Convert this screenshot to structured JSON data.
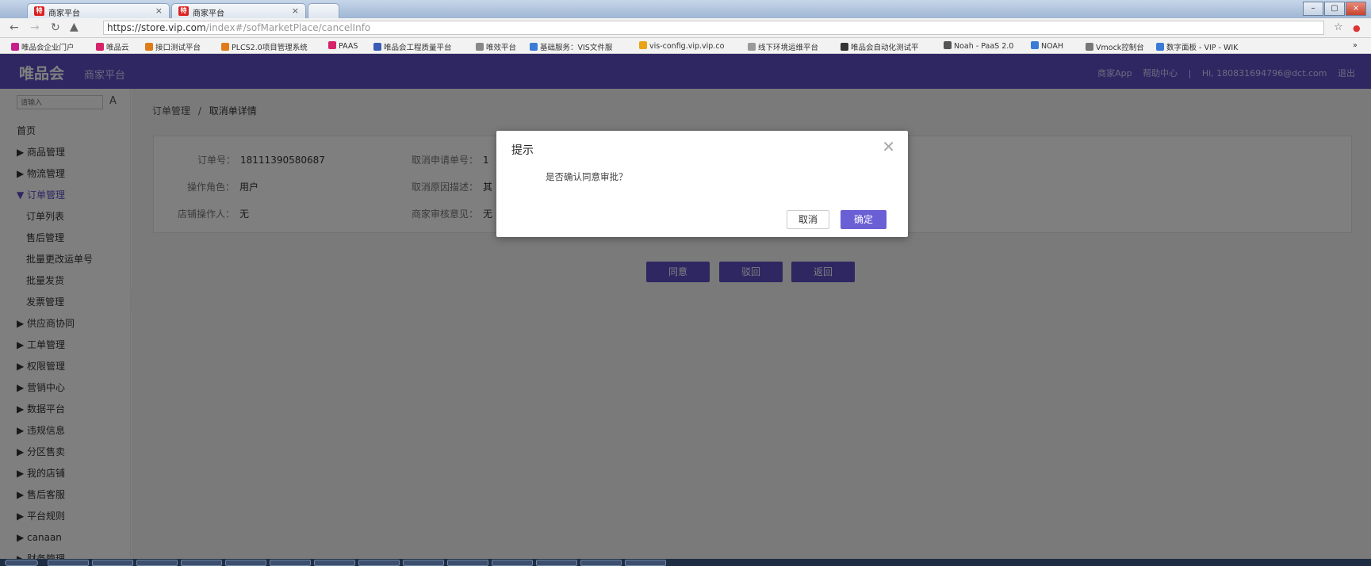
{
  "browser": {
    "tabs": [
      {
        "favicon": "特",
        "title": "商家平台"
      },
      {
        "favicon": "特",
        "title": "商家平台"
      }
    ],
    "url_host": "https://store.vip.com",
    "url_path": "/index#/sofMarketPlace/cancelInfo",
    "bookmarks": [
      {
        "label": "唯品会企业门户",
        "color": "#c81e8c"
      },
      {
        "label": "唯品云",
        "color": "#d5236a"
      },
      {
        "label": "接口测试平台",
        "color": "#e07b1a"
      },
      {
        "label": "PLCS2.0项目管理系统",
        "color": "#e07b1a"
      },
      {
        "label": "PAAS",
        "color": "#d5236a"
      },
      {
        "label": "唯品会工程质量平台",
        "color": "#3b5bb5"
      },
      {
        "label": "唯效平台",
        "color": "#888888"
      },
      {
        "label": "基础服务：VIS文件服",
        "color": "#3a7bd5"
      },
      {
        "label": "vis-config.vip.vip.co",
        "color": "#e8a317"
      },
      {
        "label": "线下环境运维平台",
        "color": "#9a9a9a"
      },
      {
        "label": "唯品会自动化测试平",
        "color": "#333333"
      },
      {
        "label": "Noah - PaaS 2.0",
        "color": "#555555"
      },
      {
        "label": "NOAH",
        "color": "#3a7bd5"
      },
      {
        "label": "Vmock控制台",
        "color": "#777777"
      },
      {
        "label": "数字面板 - VIP - WIK",
        "color": "#3a7bd5"
      }
    ]
  },
  "header": {
    "logo": "唯品会",
    "subtitle": "商家平台",
    "links": [
      "商家App",
      "帮助中心",
      "|",
      "Hi, 18083169479​6@dct.com",
      "退出"
    ]
  },
  "sidebar": {
    "search_placeholder": "请输入",
    "search_button": "A",
    "items": [
      {
        "label": "首页",
        "type": "plain"
      },
      {
        "label": "▶ 商品管理",
        "type": "group"
      },
      {
        "label": "▶ 物流管理",
        "type": "group"
      },
      {
        "label": "▼ 订单管理",
        "type": "active"
      },
      {
        "label": "订单列表",
        "type": "sub"
      },
      {
        "label": "售后管理",
        "type": "sub"
      },
      {
        "label": "批量更改运单号",
        "type": "sub"
      },
      {
        "label": "批量发货",
        "type": "sub"
      },
      {
        "label": "发票管理",
        "type": "sub"
      },
      {
        "label": "▶ 供应商协同",
        "type": "group"
      },
      {
        "label": "▶ 工单管理",
        "type": "group"
      },
      {
        "label": "▶ 权限管理",
        "type": "group"
      },
      {
        "label": "▶ 营销中心",
        "type": "group"
      },
      {
        "label": "▶ 数据平台",
        "type": "group"
      },
      {
        "label": "▶ 违规信息",
        "type": "group"
      },
      {
        "label": "▶ 分区售卖",
        "type": "group"
      },
      {
        "label": "▶ 我的店铺",
        "type": "group"
      },
      {
        "label": "▶ 售后客服",
        "type": "group"
      },
      {
        "label": "▶ 平台规则",
        "type": "group"
      },
      {
        "label": "▶ canaan",
        "type": "group"
      },
      {
        "label": "▶ 财务管理",
        "type": "group"
      }
    ]
  },
  "breadcrumb": {
    "parent": "订单管理",
    "separator": "/",
    "current": "取消单详情"
  },
  "details": {
    "order_no_label": "订单号：",
    "order_no": "18111390580687",
    "role_label": "操作角色：",
    "role": "用户",
    "operator_label": "店铺操作人：",
    "operator": "无",
    "cancel_no_label": "取消申请单号：",
    "cancel_no": "1",
    "reason_label": "取消原因描述：",
    "reason": "其",
    "opinion_label": "商家审核意见：",
    "opinion": "无"
  },
  "actions": {
    "agree": "同意",
    "reject": "驳回",
    "back": "返回"
  },
  "modal": {
    "title": "提示",
    "message": "是否确认同意审批？",
    "cancel": "取消",
    "ok": "确定"
  }
}
